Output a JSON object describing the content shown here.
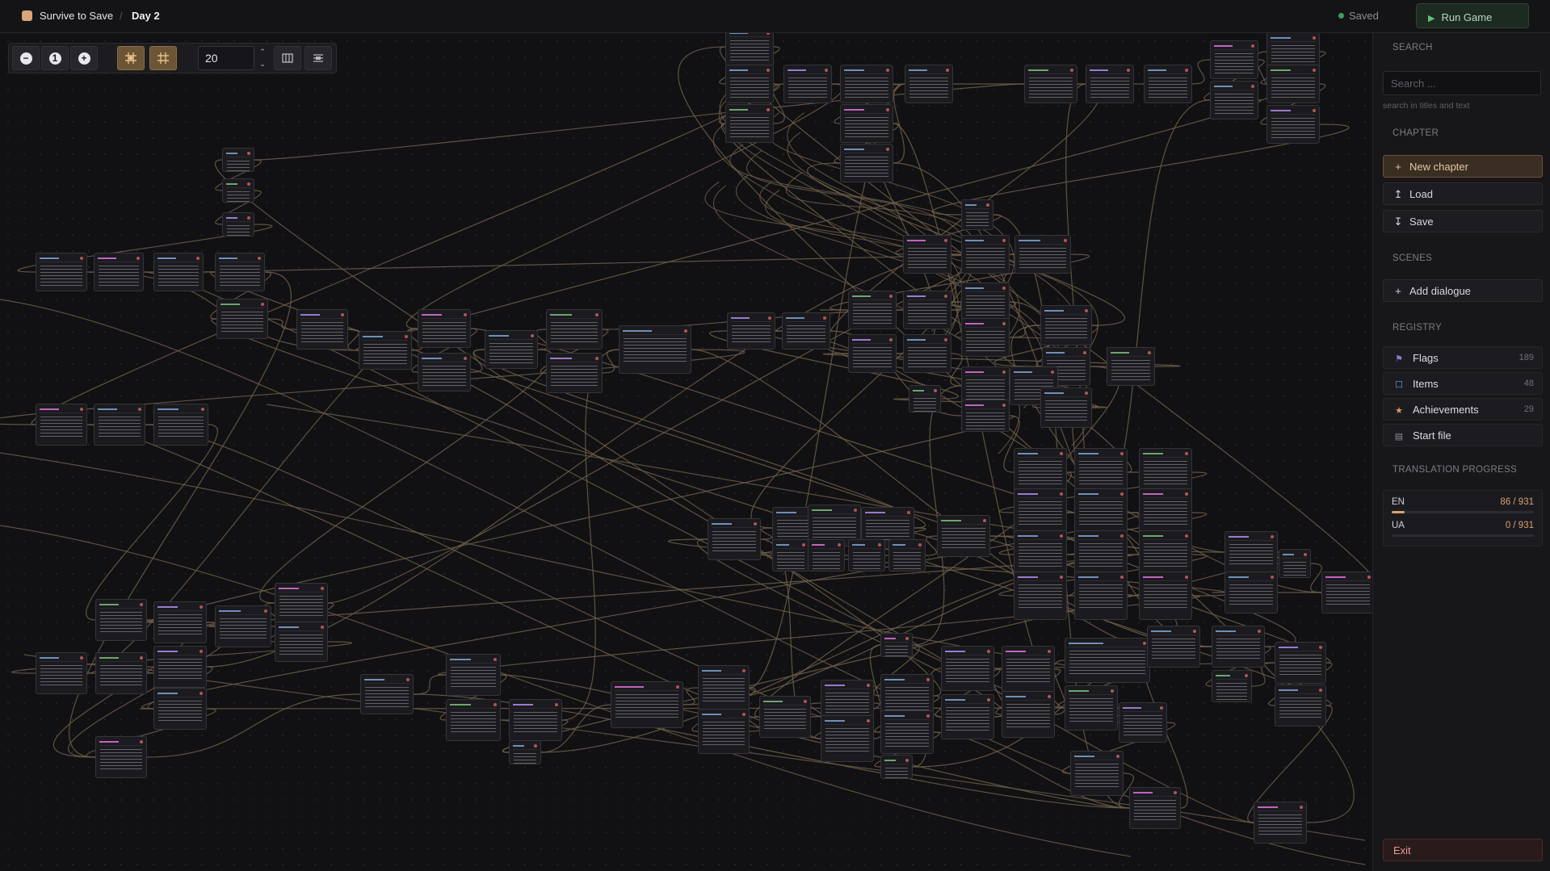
{
  "header": {
    "project_title": "Survive to Save",
    "breadcrumb_separator": "/",
    "chapter_title": "Day 2",
    "save_status": "Saved",
    "run_button_label": "Run Game"
  },
  "toolbar": {
    "zoom_out_icon": "minus-circle-icon",
    "reset_icon": "one-to-one-icon",
    "zoom_in_icon": "plus-circle-icon",
    "grid_snap_icon": "grid-snap-icon",
    "grid_toggle_icon": "grid-icon",
    "grid_size_value": "20",
    "minimap_icon": "map-icon",
    "layout_icon": "auto-layout-icon"
  },
  "sidebar": {
    "search": {
      "title": "SEARCH",
      "placeholder": "Search ...",
      "hint": "search in titles and text"
    },
    "chapter": {
      "title": "CHAPTER",
      "new_label": "New chapter",
      "load_label": "Load",
      "save_label": "Save"
    },
    "scenes": {
      "title": "SCENES",
      "add_dialogue_label": "Add dialogue"
    },
    "registry": {
      "title": "REGISTRY",
      "items": [
        {
          "label": "Flags",
          "count": "189",
          "icon": "flag-icon",
          "color": "#8f7ad6"
        },
        {
          "label": "Items",
          "count": "48",
          "icon": "box-icon",
          "color": "#6aa0d8"
        },
        {
          "label": "Achievements",
          "count": "29",
          "icon": "star-icon",
          "color": "#d89a5a"
        },
        {
          "label": "Start file",
          "count": "",
          "icon": "file-icon",
          "color": "#8c8c94"
        }
      ]
    },
    "translation": {
      "title": "TRANSLATION PROGRESS",
      "rows": [
        {
          "lang": "EN",
          "value": "86 / 931",
          "fraction": 0.0924
        },
        {
          "lang": "UA",
          "value": "0 / 931",
          "fraction": 0.0
        }
      ]
    },
    "exit_label": "Exit"
  },
  "colors": {
    "accent": "#d8a170",
    "edge": "#7d6a52",
    "background": "#111113",
    "run_green": "#5fbf7f",
    "exit_red": "#e39a9a"
  }
}
